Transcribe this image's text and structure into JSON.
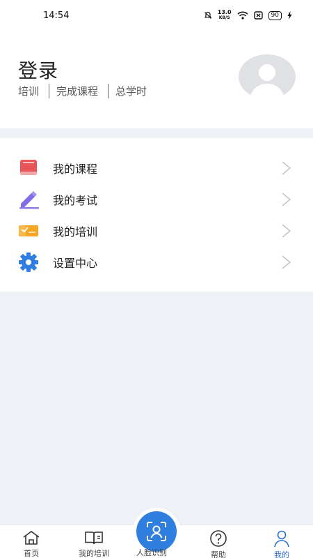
{
  "status_bar": {
    "time": "14:54",
    "net_speed_value": "13.0",
    "net_speed_unit": "KB/S",
    "battery": "90"
  },
  "profile": {
    "title": "登录",
    "stats": [
      "培训",
      "完成课程",
      "总学时"
    ]
  },
  "menu": {
    "items": [
      {
        "label": "我的课程",
        "icon": "book-icon"
      },
      {
        "label": "我的考试",
        "icon": "pencil-icon"
      },
      {
        "label": "我的培训",
        "icon": "training-icon"
      },
      {
        "label": "设置中心",
        "icon": "gear-icon"
      }
    ]
  },
  "tabbar": {
    "tabs": [
      {
        "label": "首页",
        "icon": "home-icon"
      },
      {
        "label": "我的培训",
        "icon": "open-book-icon"
      },
      {
        "label": "人脸识别",
        "icon": "face-scan-icon"
      },
      {
        "label": "帮助",
        "icon": "help-icon"
      },
      {
        "label": "我的",
        "icon": "person-icon"
      }
    ],
    "active": "我的"
  },
  "colors": {
    "accent": "#2b6fd6",
    "background": "#eef1f5"
  }
}
